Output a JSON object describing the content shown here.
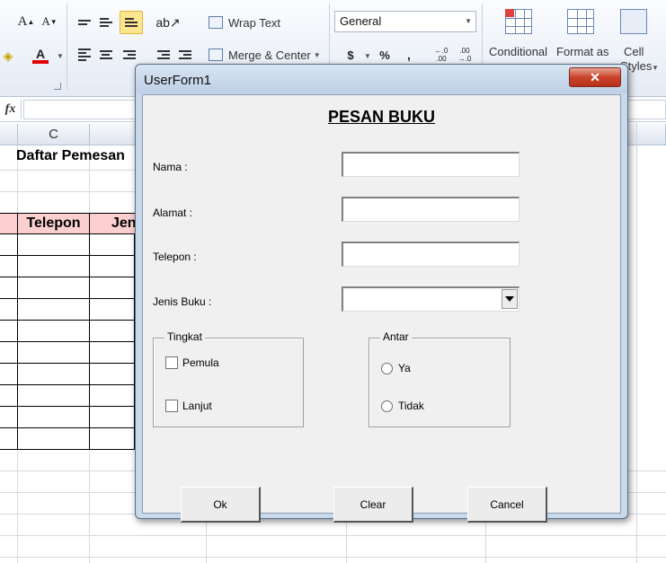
{
  "ribbon": {
    "font_grow": "A",
    "font_shrink": "A",
    "font_color": "A",
    "wrap_text": "Wrap Text",
    "merge_center": "Merge & Center",
    "number_format": "General",
    "currency": "$",
    "percent": "%",
    "comma": ",",
    "inc_decimal": "←.0\n.00",
    "dec_decimal": ".00\n→.0",
    "conditional_formatting": "Conditional",
    "format_as_table": "Format as",
    "cell_styles_top": "Cell",
    "cell_styles_bottom": "Styles"
  },
  "formula_bar": {
    "fx": "fx",
    "value": ""
  },
  "sheet": {
    "column_c": "C",
    "title": "Daftar Pemesan",
    "table_headers": [
      "Telepon",
      "Jen"
    ]
  },
  "userform": {
    "window_title": "UserForm1",
    "close_label": "✕",
    "heading": "PESAN BUKU",
    "fields": {
      "nama_label": "Nama :",
      "nama_value": "",
      "alamat_label": "Alamat :",
      "alamat_value": "",
      "telepon_label": "Telepon :",
      "telepon_value": "",
      "jenis_label": "Jenis Buku :",
      "jenis_value": ""
    },
    "tingkat": {
      "caption": "Tingkat",
      "options": [
        "Pemula",
        "Lanjut"
      ]
    },
    "antar": {
      "caption": "Antar",
      "options": [
        "Ya",
        "Tidak"
      ]
    },
    "buttons": {
      "ok": "Ok",
      "clear": "Clear",
      "cancel": "Cancel"
    }
  },
  "colors": {
    "header_fill": "#fbcfcf",
    "close_button": "#c9442b",
    "ribbon_highlight": "#fde58f"
  }
}
